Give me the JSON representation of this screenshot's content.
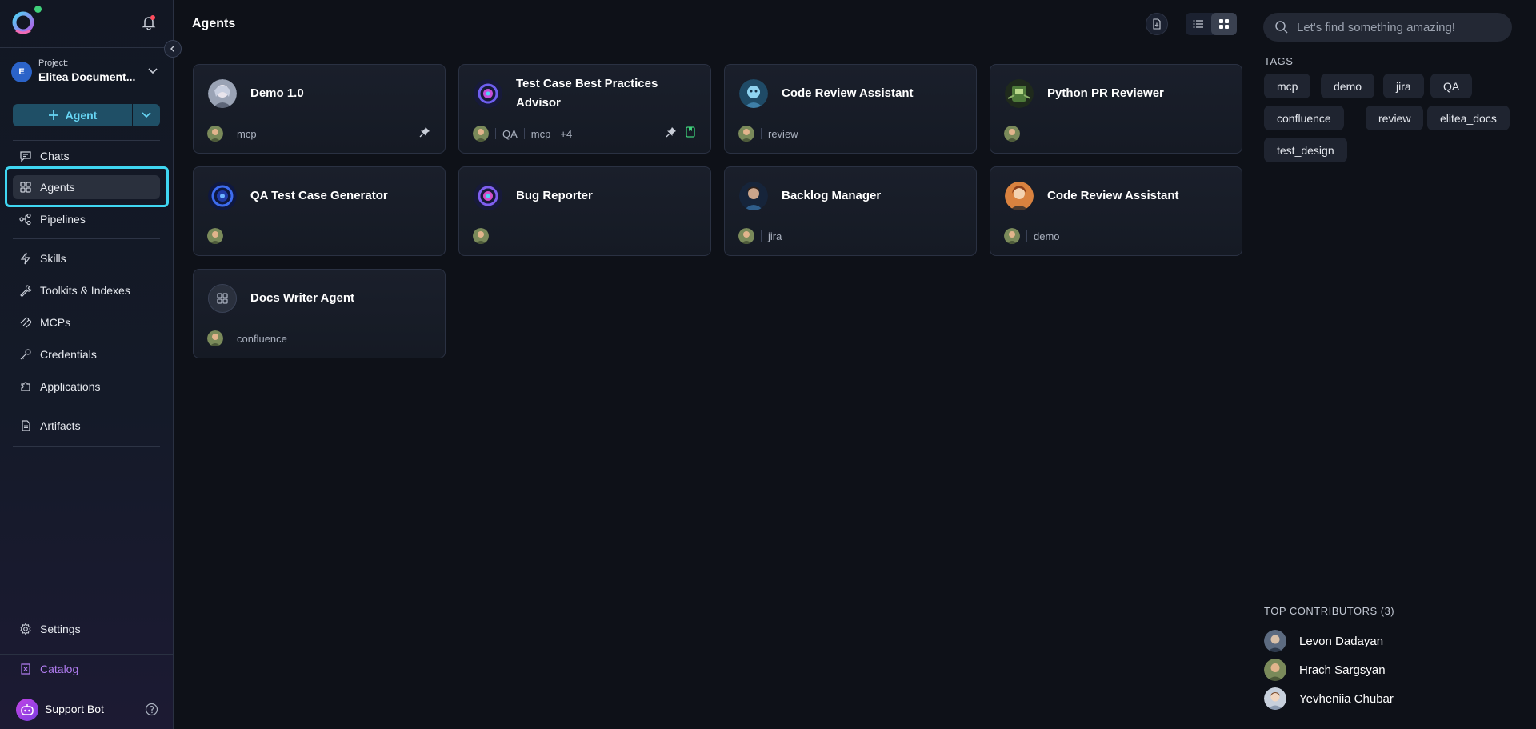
{
  "sidebar": {
    "project_label": "Project:",
    "project_name": "Elitea Document...",
    "project_initial": "E",
    "create_button_label": "Agent",
    "nav": [
      {
        "label": "Chats",
        "icon": "chat-icon"
      },
      {
        "label": "Agents",
        "icon": "agents-grid-icon",
        "active": true
      },
      {
        "label": "Pipelines",
        "icon": "pipeline-icon"
      },
      {
        "label": "Skills",
        "icon": "lightning-icon"
      },
      {
        "label": "Toolkits & Indexes",
        "icon": "wrench-icon"
      },
      {
        "label": "MCPs",
        "icon": "mcp-icon"
      },
      {
        "label": "Credentials",
        "icon": "key-icon"
      },
      {
        "label": "Applications",
        "icon": "puzzle-icon"
      },
      {
        "label": "Artifacts",
        "icon": "artifact-icon"
      }
    ],
    "settings_label": "Settings",
    "catalog_label": "Catalog",
    "support_label": "Support Bot",
    "accent_color": "#3fd6f2"
  },
  "main": {
    "title": "Agents",
    "cards": [
      {
        "title": "Demo 1.0",
        "tags": [
          "mcp"
        ],
        "more": "",
        "pinned": true,
        "bookmarked": false
      },
      {
        "title": "Test Case Best Practices Advisor",
        "tags": [
          "QA",
          "mcp"
        ],
        "more": "+4",
        "pinned": true,
        "bookmarked": true
      },
      {
        "title": "Code Review Assistant",
        "tags": [
          "review"
        ],
        "more": "",
        "pinned": false,
        "bookmarked": false
      },
      {
        "title": "Python PR Reviewer",
        "tags": [],
        "more": "",
        "pinned": false,
        "bookmarked": false
      },
      {
        "title": "QA Test Case Generator",
        "tags": [],
        "more": "",
        "pinned": false,
        "bookmarked": false
      },
      {
        "title": "Bug Reporter",
        "tags": [],
        "more": "",
        "pinned": false,
        "bookmarked": false
      },
      {
        "title": "Backlog Manager",
        "tags": [
          "jira"
        ],
        "more": "",
        "pinned": false,
        "bookmarked": false
      },
      {
        "title": "Code Review Assistant",
        "tags": [
          "demo"
        ],
        "more": "",
        "pinned": false,
        "bookmarked": false
      },
      {
        "title": "Docs Writer Agent",
        "tags": [
          "confluence"
        ],
        "more": "",
        "pinned": false,
        "bookmarked": false
      }
    ]
  },
  "right": {
    "search_placeholder": "Let's find something amazing!",
    "tags_title": "TAGS",
    "tags": [
      "mcp",
      "demo",
      "jira",
      "QA",
      "confluence",
      "review",
      "elitea_docs",
      "test_design"
    ],
    "contributors_title": "TOP CONTRIBUTORS (3)",
    "contributors": [
      "Levon Dadayan",
      "Hrach Sargsyan",
      "Yevheniia Chubar"
    ]
  }
}
